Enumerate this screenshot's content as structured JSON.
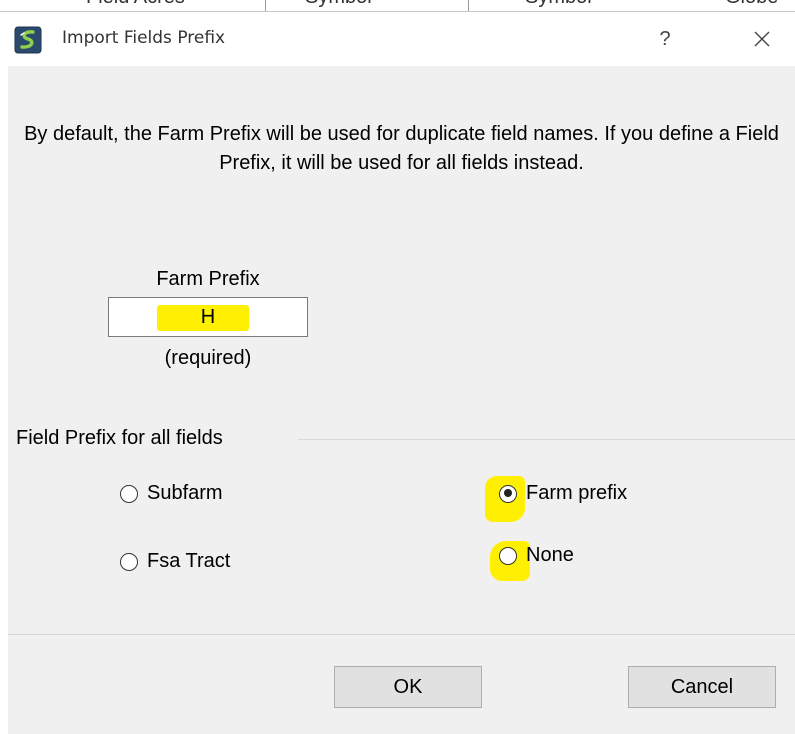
{
  "background_strip": {
    "cells": [
      "Field Acres",
      "Symbol",
      "Symbol",
      "Globe"
    ]
  },
  "window": {
    "title": "Import Fields Prefix",
    "help_label": "?",
    "icon": "app-logo-icon",
    "close_icon": "close-icon"
  },
  "intro_text": "By default, the Farm Prefix will be used for duplicate field names. If you define a Field Prefix, it will be used for all fields instead.",
  "farm_prefix": {
    "label": "Farm Prefix",
    "value": "H",
    "note": "(required)"
  },
  "field_prefix_group": {
    "title": "Field Prefix for all fields",
    "options": [
      {
        "label": "Subfarm",
        "checked": false
      },
      {
        "label": "Fsa Tract",
        "checked": false
      },
      {
        "label": "Farm prefix",
        "checked": true
      },
      {
        "label": "None",
        "checked": false
      }
    ]
  },
  "buttons": {
    "ok": "OK",
    "cancel": "Cancel"
  },
  "colors": {
    "highlight": "#ffef00",
    "client_bg": "#f0f0f0",
    "button_bg": "#e1e1e1"
  }
}
